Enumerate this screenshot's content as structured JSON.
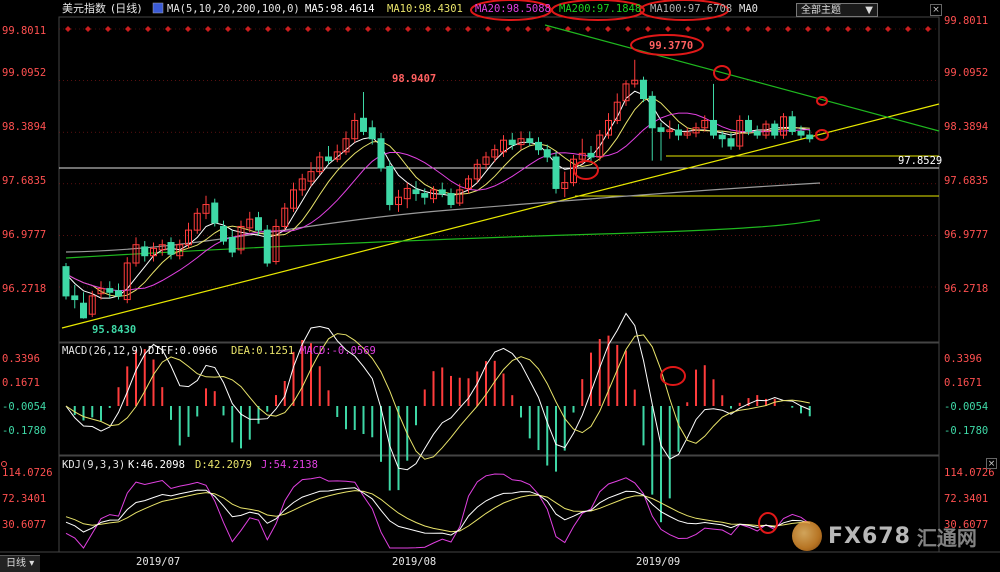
{
  "header": {
    "title": "美元指数",
    "period": "(日线)",
    "ma_params": "MA(5,10,20,200,100,0)",
    "ma5": "MA5:98.4614",
    "ma10": "MA10:98.4301",
    "ma20": "MA20:98.5088",
    "ma200": "MA200:97.1848",
    "ma100": "MA100:97.6708",
    "ma0": "MA0",
    "theme_select": "全部主题"
  },
  "price_axis": {
    "ticks": [
      "99.8011",
      "99.0952",
      "98.3894",
      "97.6835",
      "96.9777",
      "96.2718"
    ],
    "ylim": [
      95.4,
      99.95
    ]
  },
  "annotations": {
    "high1": "98.9407",
    "high2": "99.3770",
    "low1": "95.8430",
    "level_line": "97.8529"
  },
  "macd": {
    "title": "MACD(26,12,9)",
    "diff": "DIFF:0.0966",
    "dea": "DEA:0.1251",
    "macd": "MACD:-0.0569",
    "ticks": [
      "0.3396",
      "0.1671",
      "-0.0054",
      "-0.1780"
    ]
  },
  "kdj": {
    "title": "KDJ(9,3,3)",
    "k": "K:46.2098",
    "d": "D:42.2079",
    "j": "J:54.2138",
    "ticks": [
      "114.0726",
      "72.3401",
      "30.6077"
    ]
  },
  "x_axis": {
    "labels": [
      "2019/07",
      "2019/08",
      "2019/09"
    ]
  },
  "tab": {
    "label": "日线"
  },
  "watermark": {
    "text": "FX678",
    "cn": "汇通网"
  },
  "colors": {
    "up": "#ff3c3c",
    "down": "#3ed8a6",
    "ma5": "#ffffff",
    "ma10": "#e8e36a",
    "ma20": "#e040e0",
    "ma200": "#1fb81f",
    "ma100": "#9a9a9a",
    "trend": "#e8e800"
  },
  "chart_data": {
    "type": "candlestick",
    "ylim": [
      95.4,
      99.95
    ],
    "candles": [
      [
        96.55,
        96.15,
        96.6,
        96.1
      ],
      [
        96.15,
        96.1,
        96.3,
        95.98
      ],
      [
        96.05,
        95.85,
        96.2,
        95.84
      ],
      [
        95.9,
        96.15,
        96.22,
        95.86
      ],
      [
        96.18,
        96.25,
        96.35,
        96.1
      ],
      [
        96.25,
        96.2,
        96.35,
        96.12
      ],
      [
        96.22,
        96.15,
        96.32,
        96.1
      ],
      [
        96.1,
        96.6,
        96.68,
        96.05
      ],
      [
        96.6,
        96.85,
        96.95,
        96.55
      ],
      [
        96.82,
        96.7,
        96.9,
        96.62
      ],
      [
        96.7,
        96.8,
        96.88,
        96.62
      ],
      [
        96.78,
        96.85,
        96.92,
        96.7
      ],
      [
        96.88,
        96.72,
        96.95,
        96.65
      ],
      [
        96.7,
        96.85,
        96.92,
        96.65
      ],
      [
        96.85,
        97.05,
        97.15,
        96.8
      ],
      [
        97.05,
        97.28,
        97.35,
        97.0
      ],
      [
        97.28,
        97.4,
        97.52,
        97.2
      ],
      [
        97.42,
        97.15,
        97.48,
        97.1
      ],
      [
        97.1,
        96.9,
        97.18,
        96.85
      ],
      [
        96.95,
        96.75,
        97.05,
        96.68
      ],
      [
        96.78,
        97.1,
        97.18,
        96.72
      ],
      [
        97.08,
        97.2,
        97.3,
        97.02
      ],
      [
        97.22,
        97.05,
        97.3,
        96.98
      ],
      [
        97.05,
        96.6,
        97.12,
        96.55
      ],
      [
        96.62,
        97.1,
        97.2,
        96.58
      ],
      [
        97.1,
        97.35,
        97.42,
        97.05
      ],
      [
        97.35,
        97.6,
        97.7,
        97.3
      ],
      [
        97.6,
        97.75,
        97.82,
        97.52
      ],
      [
        97.72,
        97.85,
        97.98,
        97.65
      ],
      [
        97.85,
        98.05,
        98.12,
        97.8
      ],
      [
        98.05,
        98.0,
        98.2,
        97.95
      ],
      [
        98.02,
        98.12,
        98.22,
        97.98
      ],
      [
        98.12,
        98.3,
        98.4,
        98.08
      ],
      [
        98.3,
        98.55,
        98.65,
        98.25
      ],
      [
        98.58,
        98.4,
        98.94,
        98.35
      ],
      [
        98.45,
        98.3,
        98.55,
        98.22
      ],
      [
        98.3,
        97.9,
        98.38,
        97.85
      ],
      [
        97.92,
        97.4,
        98.0,
        97.32
      ],
      [
        97.4,
        97.5,
        97.6,
        97.3
      ],
      [
        97.48,
        97.62,
        97.7,
        97.35
      ],
      [
        97.6,
        97.55,
        97.72,
        97.45
      ],
      [
        97.55,
        97.5,
        97.62,
        97.4
      ],
      [
        97.48,
        97.6,
        97.65,
        97.42
      ],
      [
        97.6,
        97.55,
        97.7,
        97.5
      ],
      [
        97.55,
        97.4,
        97.62,
        97.35
      ],
      [
        97.42,
        97.6,
        97.68,
        97.38
      ],
      [
        97.62,
        97.75,
        97.8,
        97.55
      ],
      [
        97.75,
        97.95,
        98.02,
        97.7
      ],
      [
        97.95,
        98.05,
        98.12,
        97.88
      ],
      [
        98.05,
        98.15,
        98.22,
        97.98
      ],
      [
        98.12,
        98.28,
        98.35,
        98.05
      ],
      [
        98.28,
        98.22,
        98.38,
        98.15
      ],
      [
        98.22,
        98.3,
        98.4,
        98.15
      ],
      [
        98.3,
        98.25,
        98.4,
        98.2
      ],
      [
        98.25,
        98.15,
        98.32,
        98.08
      ],
      [
        98.15,
        98.05,
        98.22,
        97.98
      ],
      [
        98.05,
        97.62,
        98.12,
        97.55
      ],
      [
        97.62,
        97.7,
        97.85,
        97.5
      ],
      [
        97.7,
        98.02,
        98.08,
        97.65
      ],
      [
        98.02,
        98.1,
        98.3,
        97.95
      ],
      [
        98.1,
        98.05,
        98.2,
        97.98
      ],
      [
        98.05,
        98.35,
        98.42,
        98.0
      ],
      [
        98.35,
        98.55,
        98.65,
        98.3
      ],
      [
        98.55,
        98.8,
        98.92,
        98.5
      ],
      [
        98.82,
        99.05,
        99.1,
        98.75
      ],
      [
        99.05,
        99.1,
        99.38,
        99.0
      ],
      [
        99.1,
        98.85,
        99.15,
        98.8
      ],
      [
        98.88,
        98.45,
        98.95,
        98.0
      ],
      [
        98.45,
        98.4,
        98.52,
        98.0
      ],
      [
        98.4,
        98.42,
        98.55,
        98.3
      ],
      [
        98.42,
        98.35,
        98.5,
        98.28
      ],
      [
        98.35,
        98.38,
        98.45,
        98.3
      ],
      [
        98.38,
        98.45,
        98.52,
        98.32
      ],
      [
        98.45,
        98.55,
        98.62,
        98.4
      ],
      [
        98.55,
        98.35,
        99.05,
        98.3
      ],
      [
        98.35,
        98.3,
        98.4,
        98.18
      ],
      [
        98.3,
        98.2,
        98.38,
        98.15
      ],
      [
        98.2,
        98.55,
        98.62,
        98.15
      ],
      [
        98.55,
        98.4,
        98.62,
        98.35
      ],
      [
        98.4,
        98.35,
        98.48,
        98.3
      ],
      [
        98.35,
        98.5,
        98.55,
        98.3
      ],
      [
        98.5,
        98.35,
        98.55,
        98.3
      ],
      [
        98.35,
        98.6,
        98.65,
        98.3
      ],
      [
        98.6,
        98.4,
        98.68,
        98.35
      ],
      [
        98.4,
        98.35,
        98.48,
        98.3
      ],
      [
        98.35,
        98.3,
        98.42,
        98.25
      ]
    ],
    "ma5": [
      96.45,
      96.32,
      96.22,
      96.18,
      96.12,
      96.12,
      96.15,
      96.25,
      96.4,
      96.55,
      96.7,
      96.78,
      96.8,
      96.78,
      96.85,
      96.95,
      97.1,
      97.15,
      97.12,
      97.05,
      97.02,
      97.0,
      96.98,
      96.95,
      96.98,
      97.05,
      97.25,
      97.45,
      97.65,
      97.8,
      97.95,
      98.05,
      98.15,
      98.25,
      98.3,
      98.32,
      98.2,
      97.98,
      97.8,
      97.7,
      97.62,
      97.58,
      97.55,
      97.54,
      97.52,
      97.55,
      97.6,
      97.7,
      97.85,
      98.0,
      98.12,
      98.2,
      98.25,
      98.25,
      98.22,
      98.1,
      97.95,
      97.88,
      97.9,
      97.95,
      98.05,
      98.2,
      98.4,
      98.6,
      98.85,
      98.95,
      98.9,
      98.75,
      98.55,
      98.45,
      98.4,
      98.4,
      98.42,
      98.42,
      98.4,
      98.38,
      98.35,
      98.38,
      98.4,
      98.42,
      98.42,
      98.45,
      98.45,
      98.46,
      98.44,
      98.42
    ]
  }
}
